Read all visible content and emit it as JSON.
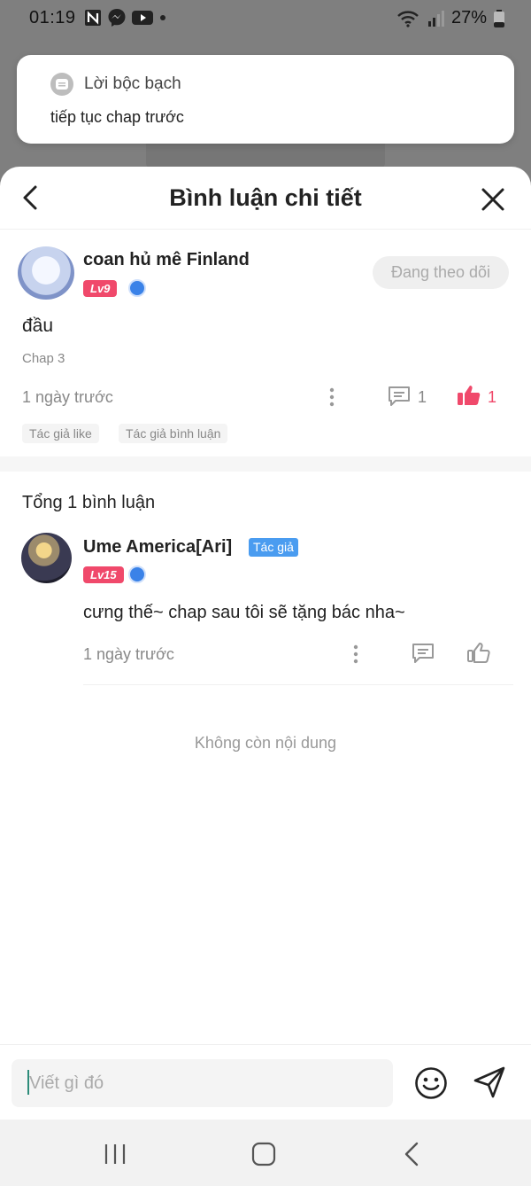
{
  "status_bar": {
    "time": "01:19",
    "battery": "27%",
    "icons": [
      "n-icon",
      "messenger-icon",
      "youtube-icon",
      "dot-icon",
      "wifi-icon",
      "signal-icon",
      "battery-icon"
    ]
  },
  "notification": {
    "app_name": "Lời bộc bạch",
    "message": "tiếp tục chap trước"
  },
  "sheet": {
    "title": "Bình luận chi tiết"
  },
  "original_comment": {
    "user": "coan hủ mê Finland",
    "level": "Lv9",
    "follow_label": "Đang theo dõi",
    "text": "đầu",
    "chapter": "Chap 3",
    "time": "1 ngày trước",
    "reply_count": "1",
    "like_count": "1",
    "tags": [
      "Tác giả like",
      "Tác giả bình luận"
    ]
  },
  "replies": {
    "total_label": "Tổng 1 bình luận",
    "items": [
      {
        "user": "Ume America[Ari]",
        "author_tag": "Tác giả",
        "level": "Lv15",
        "text": "cưng thế~ chap sau tôi sẽ tặng bác nha~",
        "time": "1 ngày trước"
      }
    ],
    "end_label": "Không còn nội dung"
  },
  "input": {
    "placeholder": "Viết gì đó"
  },
  "colors": {
    "accent_red": "#f0496b",
    "author_blue": "#4a9cf0"
  }
}
